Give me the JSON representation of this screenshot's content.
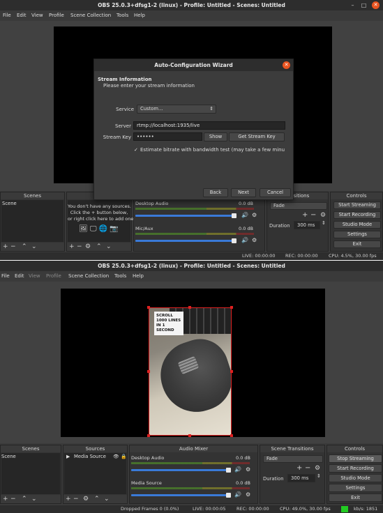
{
  "window1": {
    "title": "OBS 25.0.3+dfsg1-2 (linux) - Profile: Untitled - Scenes: Untitled",
    "menu": [
      "File",
      "Edit",
      "View",
      "Profile",
      "Scene Collection",
      "Tools",
      "Help"
    ],
    "scenes_title": "Scenes",
    "scene_item": "Scene",
    "sources_title": "So",
    "sources_empty_text": [
      "You don't have any sources.",
      "Click the + button below,",
      "or right click here to add one."
    ],
    "mixer": [
      {
        "name": "Desktop Audio",
        "db": "0.0 dB"
      },
      {
        "name": "Mic/Aux",
        "db": "0.0 dB"
      }
    ],
    "transitions_title": "ransitions",
    "transition_value": "Fade",
    "duration_label": "Duration",
    "duration_value": "300 ms",
    "controls_title": "Controls",
    "controls": [
      "Start Streaming",
      "Start Recording",
      "Studio Mode",
      "Settings",
      "Exit"
    ],
    "status": {
      "live": "LIVE: 00:00:00",
      "rec": "REC: 00:00:00",
      "cpu": "CPU: 4.5%, 30.00 fps"
    },
    "dialog": {
      "title": "Auto-Configuration Wizard",
      "heading": "Stream Information",
      "subheading": "Please enter your stream information",
      "service_label": "Service",
      "service_value": "Custom...",
      "server_label": "Server",
      "server_value": "rtmp://localhost:1935/live",
      "key_label": "Stream Key",
      "key_value": "••••••",
      "show_label": "Show",
      "get_key_label": "Get Stream Key",
      "checkbox_label": "Estimate bitrate with bandwidth test (may take a few minut",
      "back_label": "Back",
      "next_label": "Next",
      "cancel_label": "Cancel"
    }
  },
  "window2": {
    "title": "OBS 25.0.3+dfsg1-2 (linux) - Profile: Untitled - Scenes: Untitled",
    "menu": [
      "File",
      "Edit",
      "View",
      "Profile",
      "Scene Collection",
      "Tools",
      "Help"
    ],
    "video_caption": [
      "SCROLL",
      "1000 LINES",
      "IN 1 SECOND"
    ],
    "scenes_title": "Scenes",
    "scene_item": "Scene",
    "sources_title": "Sources",
    "source_item": "Media Source",
    "mixer_title": "Audio Mixer",
    "mixer": [
      {
        "name": "Desktop Audio",
        "db": "0.0 dB"
      },
      {
        "name": "Media Source",
        "db": "0.0 dB"
      }
    ],
    "transitions_title": "Scene Transitions",
    "transition_value": "Fade",
    "duration_label": "Duration",
    "duration_value": "300 ms",
    "controls_title": "Controls",
    "controls": [
      "Stop Streaming",
      "Start Recording",
      "Studio Mode",
      "Settings",
      "Exit"
    ],
    "status": {
      "dropped": "Dropped Frames 0 (0.0%)",
      "live": "LIVE: 00:00:05",
      "rec": "REC: 00:00:00",
      "cpu": "CPU: 49.0%, 30.00 fps",
      "kbps": "kb/s: 1851"
    }
  },
  "colors": {
    "accent": "#e95420",
    "selection": "#e02020",
    "meter_green": "#4a7a2a",
    "volume_blue": "#3a7ad8",
    "status_ok": "#22cc22"
  }
}
